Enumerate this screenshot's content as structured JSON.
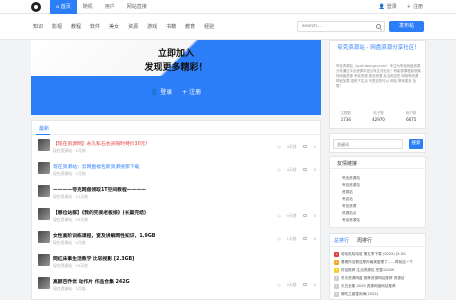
{
  "topbar": {
    "nav": [
      {
        "label": "⌂ 首页",
        "active": true
      },
      {
        "label": "随机",
        "active": false
      },
      {
        "label": "用户",
        "active": false
      },
      {
        "label": "网站直接",
        "active": false
      }
    ],
    "login": "登录",
    "register": "注册"
  },
  "catbar": {
    "items": [
      "知识",
      "影视",
      "教程",
      "软件",
      "美女",
      "资源",
      "游戏",
      "书籍",
      "教育",
      "经验"
    ],
    "search_placeholder": "search...",
    "post_button": "发布帖"
  },
  "hero": {
    "line1": "立即加入",
    "line2": "发现更多精彩！",
    "login": "登录",
    "register": "注册"
  },
  "latest": {
    "tab": "最新",
    "posts": [
      {
        "title": "【现在资源网】永久私石会员限时特价30元！",
        "style": "red",
        "meta": "现在资源站 · 1月前",
        "views": "4天前",
        "replies": "1"
      },
      {
        "title": "现在资源站：云网盘福包新资源搜索下载",
        "style": "blue",
        "meta": "现在资源站 · 1月前",
        "views": "4天前",
        "replies": "9"
      },
      {
        "title": "————夸克网盘领取1T空间教程————",
        "style": "dark",
        "meta": "现在资源站 · 11天前",
        "views": "",
        "replies": ""
      },
      {
        "title": "【哪位站群】《我的完美老板娘》(长篇完结)",
        "style": "dark",
        "meta": "现在资源站 · 19天前",
        "views": "0天前",
        "replies": "3"
      },
      {
        "title": "女性高阶训练课程，宽及讲解网性知识，1.9GB",
        "style": "dark",
        "meta": "现在资源站 · 1月前",
        "views": "1天前",
        "replies": "0"
      },
      {
        "title": "网红床事生活教学 比较视影 [2.3GB]",
        "style": "dark",
        "meta": "现在资源站 · 19天前",
        "views": "",
        "replies": ""
      },
      {
        "title": "高颜芭乔优 动作片 作品合集 242G",
        "style": "dark",
        "meta": "现在资源站 · 1月前",
        "views": "0天前",
        "replies": "0"
      }
    ]
  },
  "about": {
    "title": "夸克资源站 - 网盘资源分享社区！",
    "desc": "夸克资源站（quzhiwangzy.com）专注为夸克网盘资源分享通过平台资源丰富分享交流社区！有影视课程影视素材网盘资源 夸克资源 原创资源 及当前这些 网络等资源 再就加载 感受下生活 不是这些可以 网站 联系更多 加载！",
    "stats": [
      {
        "label": "主题数",
        "value": "1736"
      },
      {
        "label": "帖子数",
        "value": "42970"
      },
      {
        "label": "用户数",
        "value": "6675"
      }
    ]
  },
  "side_search": {
    "placeholder": "关键词",
    "button": "搜索"
  },
  "links": {
    "title": "友情链接",
    "items": [
      "夸克资源站",
      "夸克资源站",
      "资源站",
      "夸克站",
      "夸克资源",
      "资源站点",
      "夸克资源站"
    ]
  },
  "hot": {
    "tabs": [
      "总排行",
      "周排行"
    ],
    "items": [
      "哈哈哈哈哈哈 第五季下载 (2025) [4.5G",
      "看看你没看这是你最美整理了……再就这一下",
      "好品推荐 生活资源包 完整12000",
      "冬天资源网盘 推荐资源网站推荐 资源站",
      "长白全集 2025 资源网盘网站推荐",
      "哪吃之魔童闹海(2025)"
    ]
  }
}
